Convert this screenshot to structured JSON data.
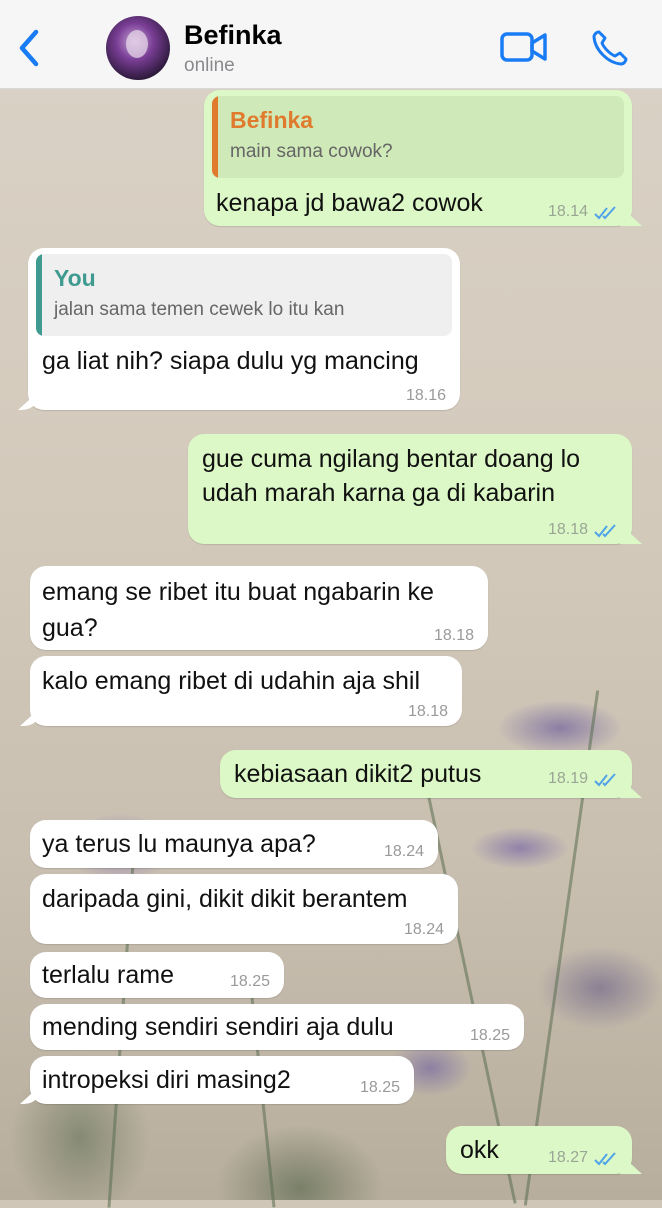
{
  "header": {
    "contact_name": "Befinka",
    "status": "online"
  },
  "colors": {
    "ios_blue": "#1a7cf5",
    "outgoing_bubble": "#dcf8c6",
    "incoming_bubble": "#ffffff",
    "quote_orange": "#e07a2d",
    "quote_teal": "#3f9a8f",
    "read_ticks": "#4fa3e8"
  },
  "messages": [
    {
      "direction": "out",
      "quote": {
        "author": "Befinka",
        "text": "main sama cowok?"
      },
      "text": "kenapa jd bawa2 cowok",
      "time": "18.14",
      "read": true
    },
    {
      "direction": "in",
      "quote": {
        "author": "You",
        "text": "jalan sama temen cewek lo itu kan"
      },
      "text": "ga liat nih? siapa dulu yg mancing",
      "time": "18.16"
    },
    {
      "direction": "out",
      "text": "gue cuma ngilang bentar doang lo udah marah karna ga di kabarin",
      "time": "18.18",
      "read": true
    },
    {
      "direction": "in",
      "text": "emang se ribet itu buat ngabarin ke gua?",
      "time": "18.18"
    },
    {
      "direction": "in",
      "text": "kalo emang ribet di udahin aja shil",
      "time": "18.18"
    },
    {
      "direction": "out",
      "text": "kebiasaan dikit2 putus",
      "time": "18.19",
      "read": true
    },
    {
      "direction": "in",
      "text": "ya terus lu maunya apa?",
      "time": "18.24"
    },
    {
      "direction": "in",
      "text": "daripada gini, dikit dikit berantem",
      "time": "18.24"
    },
    {
      "direction": "in",
      "text": "terlalu rame",
      "time": "18.25"
    },
    {
      "direction": "in",
      "text": "mending sendiri sendiri aja dulu",
      "time": "18.25"
    },
    {
      "direction": "in",
      "text": "intropeksi diri masing2",
      "time": "18.25"
    },
    {
      "direction": "out",
      "text": "okk",
      "time": "18.27",
      "read": true
    }
  ]
}
